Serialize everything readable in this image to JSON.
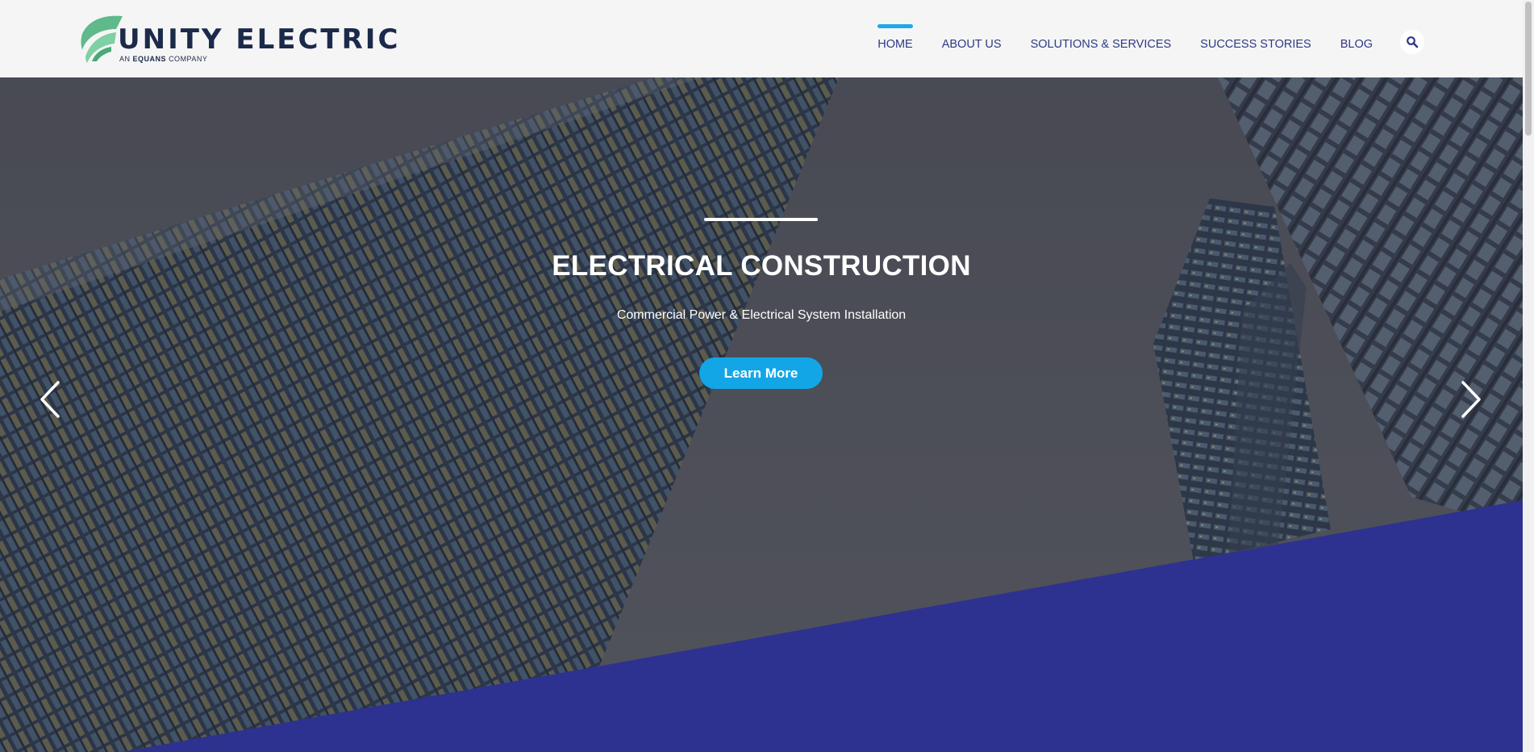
{
  "brand": {
    "name": "UNITY ELECTRIC",
    "tagline_prefix": "AN",
    "tagline_brand": "EQUANS",
    "tagline_suffix": "COMPANY",
    "logo_icon": "leaf-logo-icon"
  },
  "nav": {
    "items": [
      {
        "label": "HOME",
        "active": true
      },
      {
        "label": "ABOUT US",
        "active": false
      },
      {
        "label": "SOLUTIONS & SERVICES",
        "active": false
      },
      {
        "label": "SUCCESS STORIES",
        "active": false
      },
      {
        "label": "BLOG",
        "active": false
      }
    ],
    "search_icon": "search-icon"
  },
  "hero": {
    "title": "ELECTRICAL CONSTRUCTION",
    "subtitle": "Commercial Power & Electrical System Installation",
    "cta_label": "Learn More",
    "prev_icon": "chevron-left-icon",
    "next_icon": "chevron-right-icon"
  },
  "colors": {
    "header_bg": "#f5f5f5",
    "nav_text": "#2e3a87",
    "nav_active_bar": "#1ea9e6",
    "brand_dark": "#1b2a4a",
    "logo_green": "#5fb98a",
    "cta_bg": "#13a6e6",
    "hero_overlay": "#5a5c66",
    "diagonal_band": "#2d3290"
  }
}
